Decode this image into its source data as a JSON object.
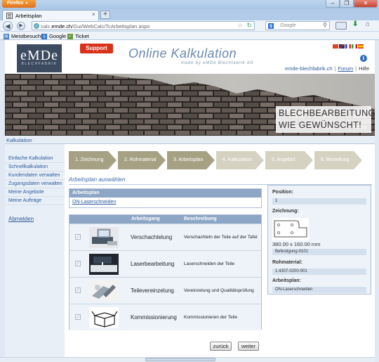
{
  "browser": {
    "app_button": "Firefox",
    "tab_title": "Arbeitsplan",
    "new_tab": "+",
    "url_prefix": "calc.",
    "url_domain": "emde.ch",
    "url_path": "/Gui/WebCalc/TcArbeitsplan.aspx",
    "search_placeholder": "Google",
    "bookmarks": [
      "Meistbesucht",
      "Google",
      "Ticket"
    ]
  },
  "header": {
    "logo_main": "eMDe",
    "logo_sub": "BLECHFABRIK",
    "support": "Support",
    "title": "Online Kalkulation",
    "subtitle": "made by eMDe Blechfabrik AG",
    "info": "i",
    "link_site": "emde-blechfabrik.ch",
    "link_forum": "Forum",
    "link_help": "Hilfe",
    "sep": "|"
  },
  "banner": {
    "line1": "BLECHBEARBEITUNG",
    "line2": "WIE GEWÜNSCHT!"
  },
  "breadcrumb": "Kalkulation",
  "sidebar": {
    "items": [
      "Einfache Kalkulation",
      "Schnellkalkulation",
      "Kundendaten verwalten",
      "Zugangsdaten verwalten",
      "Meine Angebote",
      "Meine Aufträge"
    ],
    "logout": "Abmelden"
  },
  "steps": [
    "1. Zeichnung",
    "2. Rohmaterial",
    "3. Arbeitsplan",
    "4. Kalkulation",
    "5. Angebot",
    "6. Bestellung"
  ],
  "section_title": "Arbeitsplan auswählen",
  "arbeitsplan": {
    "header": "Arbeitsplan",
    "link": "ON-Laserschneiden"
  },
  "grid": {
    "col_step": "Arbeitsgang",
    "col_desc": "Beschreibung",
    "rows": [
      {
        "name": "Verschachtelung",
        "desc": "Verschachteln der Teile auf der Tafel"
      },
      {
        "name": "Laserbearbeitung",
        "desc": "Laserschneiden der Teile"
      },
      {
        "name": "Teilevereinzelung",
        "desc": "Vereinzelung und Qualitätsprüfung"
      },
      {
        "name": "Kommissionierung",
        "desc": "Kommissionieren der Teile"
      }
    ]
  },
  "info": {
    "position_label": "Position:",
    "position_value": "1",
    "drawing_label": "Zeichnung:",
    "drawing_dims": "380.00 x 160.00 mm",
    "drawing_name": "Befestigung-0101",
    "material_label": "Rohmaterial:",
    "material_value": "1.4307-0200-001",
    "plan_label": "Arbeitsplan:",
    "plan_value": "ON-Laserschneiden"
  },
  "buttons": {
    "back": "zurück",
    "next": "weiter"
  }
}
